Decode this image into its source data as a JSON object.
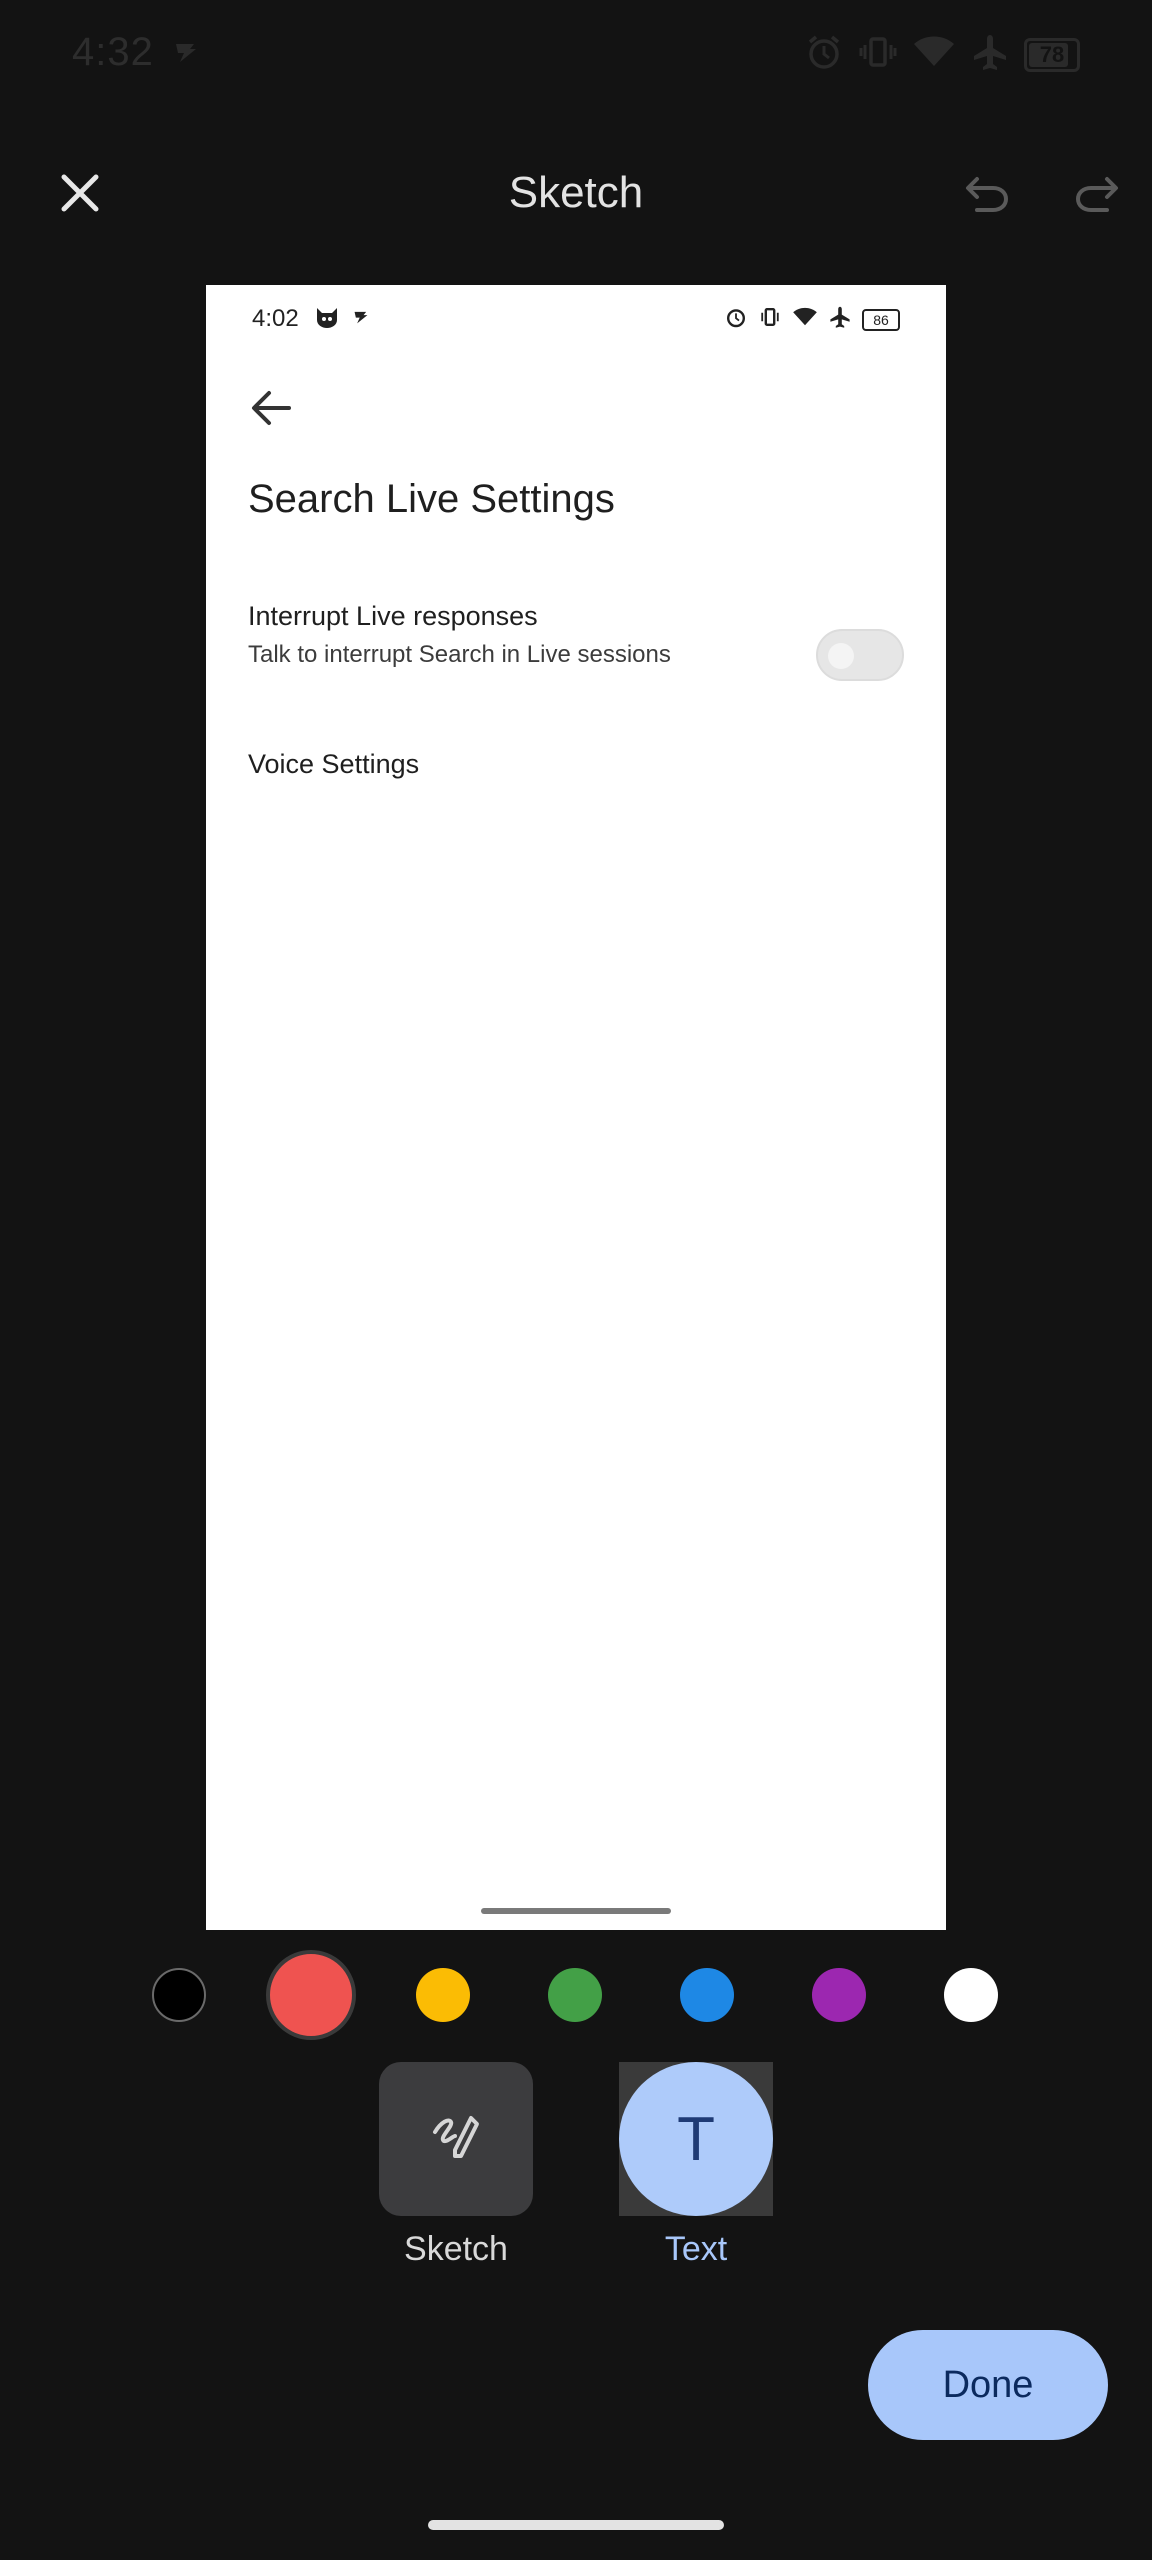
{
  "status_bar": {
    "time": "4:32",
    "battery_level": "78",
    "icons": [
      "alarm-icon",
      "vibrate-icon",
      "wifi-icon",
      "airplane-icon",
      "battery-icon"
    ]
  },
  "app_bar": {
    "title": "Sketch",
    "close_icon": "close-icon",
    "undo_icon": "undo-icon",
    "redo_icon": "redo-icon"
  },
  "canvas": {
    "status_time": "4:02",
    "battery": "86",
    "title": "Search Live Settings",
    "setting": {
      "label": "Interrupt Live responses",
      "description": "Talk to interrupt Search in Live sessions",
      "enabled": false
    },
    "section": "Voice Settings"
  },
  "palette": {
    "colors": [
      {
        "name": "black",
        "hex": "#000000"
      },
      {
        "name": "red",
        "hex": "#ef5350",
        "selected": true
      },
      {
        "name": "yellow",
        "hex": "#fbbc04"
      },
      {
        "name": "green",
        "hex": "#43a047"
      },
      {
        "name": "blue",
        "hex": "#1e88e5"
      },
      {
        "name": "purple",
        "hex": "#9c27b0"
      },
      {
        "name": "white",
        "hex": "#ffffff"
      }
    ]
  },
  "tools": {
    "sketch_label": "Sketch",
    "text_label": "Text",
    "text_glyph": "T",
    "selected": "Text"
  },
  "done_label": "Done"
}
